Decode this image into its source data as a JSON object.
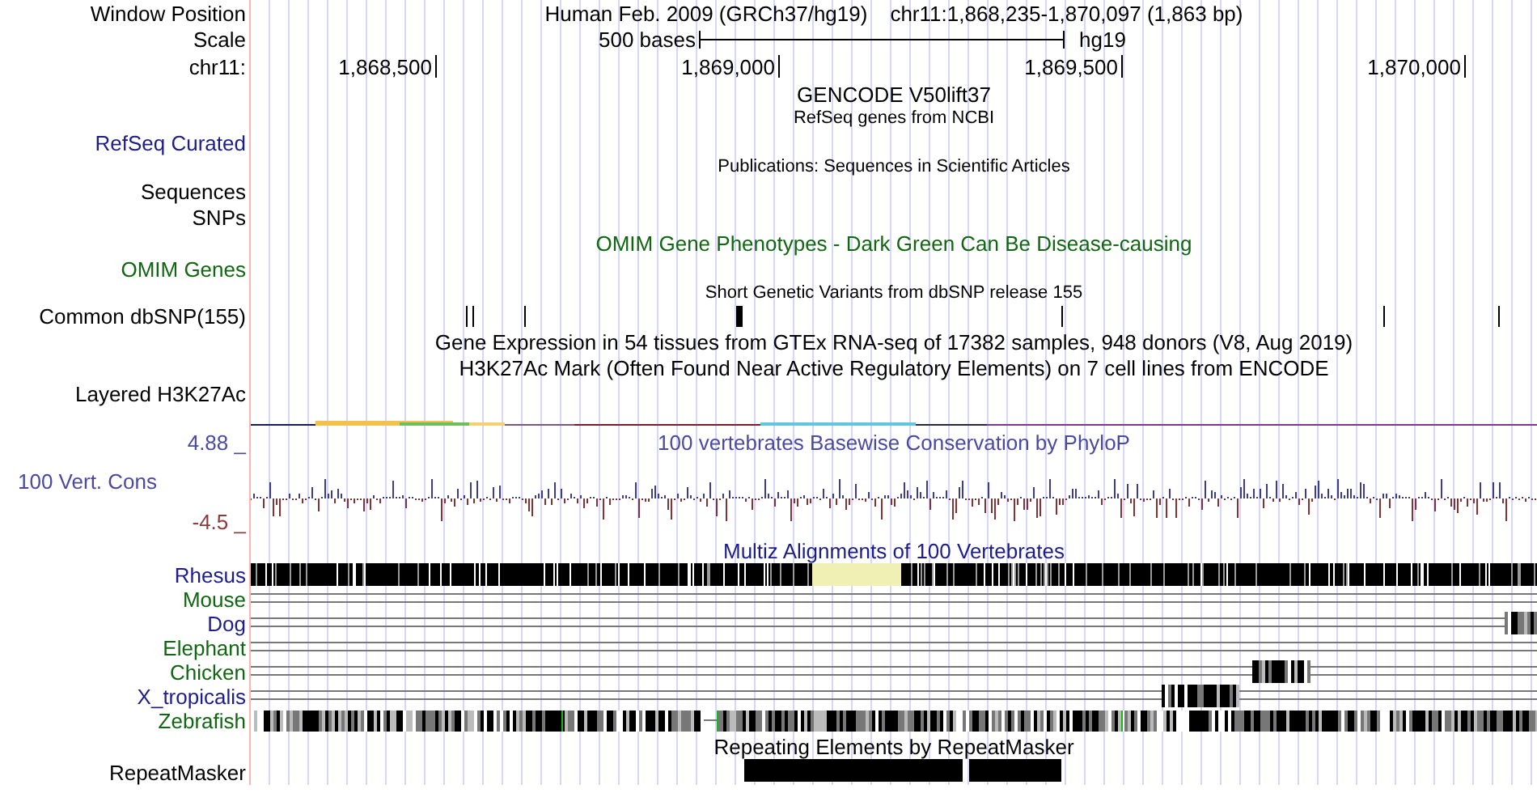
{
  "tracks": [
    {
      "kind": "position",
      "label": "Window Position",
      "assembly": "Human Feb. 2009 (GRCh37/hg19)",
      "position": "chr11:1,868,235-1,870,097 (1,863 bp)"
    },
    {
      "kind": "scale",
      "label": "Scale",
      "length": "500 bases",
      "assembly": "hg19"
    },
    {
      "kind": "ruler",
      "label": "chr11:",
      "ticks": [
        "1,868,500",
        "1,869,000",
        "1,869,500",
        "1,870,000"
      ]
    },
    {
      "kind": "title",
      "text": "GENCODE V50lift37",
      "color": "#000000"
    },
    {
      "kind": "caption",
      "text": "RefSeq genes from NCBI"
    },
    {
      "kind": "label",
      "label": "RefSeq Curated",
      "color": "#1c1c8a"
    },
    {
      "kind": "caption",
      "text": "Publications: Sequences in Scientific Articles"
    },
    {
      "kind": "label",
      "label": "Sequences",
      "color": "#000000"
    },
    {
      "kind": "label",
      "label": "SNPs",
      "color": "#000000"
    },
    {
      "kind": "title",
      "text": "OMIM Gene Phenotypes - Dark Green Can Be Disease-causing",
      "color": "#116611"
    },
    {
      "kind": "label",
      "label": "OMIM Genes",
      "color": "#116611"
    },
    {
      "kind": "caption",
      "text": "Short Genetic Variants from dbSNP release 155"
    },
    {
      "kind": "snp",
      "label": "Common dbSNP(155)"
    },
    {
      "kind": "title",
      "text": "Gene Expression in 54 tissues from GTEx RNA-seq of 17382 samples, 948 donors (V8, Aug 2019)",
      "color": "#000000"
    },
    {
      "kind": "title",
      "text": "H3K27Ac Mark (Often Found Near Active Regulatory Elements) on 7 cell lines from ENCODE",
      "color": "#000000"
    },
    {
      "kind": "label",
      "label": "Layered H3K27Ac",
      "color": "#000000"
    },
    {
      "kind": "signal"
    },
    {
      "kind": "wiggle",
      "max": "4.88 _",
      "title": "100 vertebrates Basewise Conservation by PhyloP",
      "label": "100 Vert. Cons",
      "min": "-4.5 _"
    },
    {
      "kind": "title",
      "text": "Multiz Alignments of 100 Vertebrates",
      "color": "#1c1c8a"
    },
    {
      "kind": "alignment",
      "label": "Rhesus",
      "color": "#1c1c8a"
    },
    {
      "kind": "alignment",
      "label": "Mouse",
      "color": "#116611"
    },
    {
      "kind": "alignment",
      "label": "Dog",
      "color": "#1c1c8a"
    },
    {
      "kind": "alignment",
      "label": "Elephant",
      "color": "#116611"
    },
    {
      "kind": "alignment",
      "label": "Chicken",
      "color": "#116611"
    },
    {
      "kind": "alignment",
      "label": "X_tropicalis",
      "color": "#1c1c8a"
    },
    {
      "kind": "alignment",
      "label": "Zebrafish",
      "color": "#116611"
    },
    {
      "kind": "title",
      "text": "Repeating Elements by RepeatMasker",
      "color": "#000000"
    },
    {
      "kind": "repeat",
      "label": "RepeatMasker"
    }
  ]
}
